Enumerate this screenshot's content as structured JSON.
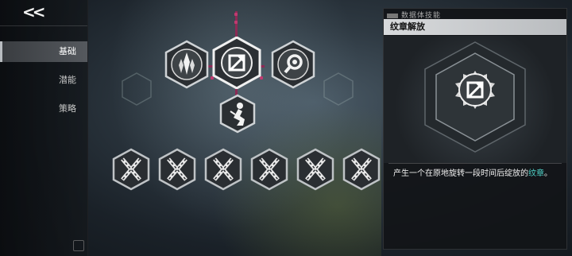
{
  "nav": {
    "back_label": "<<",
    "tabs": [
      {
        "label": "基础",
        "active": true
      },
      {
        "label": "潜能",
        "active": false
      },
      {
        "label": "策略",
        "active": false
      }
    ]
  },
  "skill_tree": {
    "top_row": [
      {
        "icon": "crystal-cluster-icon",
        "state": "unlocked"
      },
      {
        "icon": "emblem-release-icon",
        "state": "selected"
      },
      {
        "icon": "magnifier-ring-icon",
        "state": "unlocked"
      }
    ],
    "middle": {
      "icon": "kneeling-figure-icon",
      "state": "unlocked"
    },
    "bottom_row_count": 6,
    "bottom_row_icon": "locked-x-chain-icon",
    "connector_color": "#8c2a55"
  },
  "panel": {
    "category": "数据体技能",
    "title": "纹章解放",
    "art_icon": "emblem-release-icon",
    "description_main": "产生一个在原地旋转一段时间后绽放的",
    "description_keyword": "纹章",
    "description_end": "。",
    "keyword_color": "#4fd2c8"
  }
}
